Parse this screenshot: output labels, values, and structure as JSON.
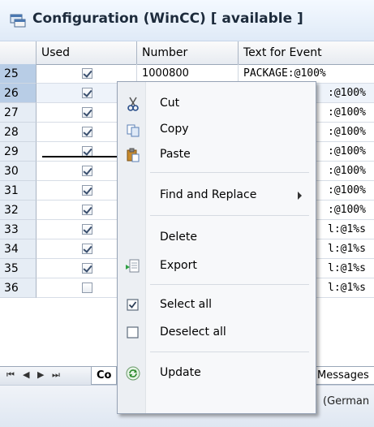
{
  "title": "Configuration (WinCC) [ available ]",
  "columns": [
    "Used",
    "Number",
    "Text for Event"
  ],
  "rows": [
    {
      "num": "25",
      "used": true,
      "number": "1000800",
      "text": "PACKAGE:@100%"
    },
    {
      "num": "26",
      "used": true,
      "number": "",
      "text": ":@100%"
    },
    {
      "num": "27",
      "used": true,
      "number": "",
      "text": ":@100%"
    },
    {
      "num": "28",
      "used": true,
      "number": "",
      "text": ":@100%"
    },
    {
      "num": "29",
      "used": true,
      "number": "",
      "text": ":@100%"
    },
    {
      "num": "30",
      "used": true,
      "number": "",
      "text": ":@100%"
    },
    {
      "num": "31",
      "used": true,
      "number": "",
      "text": ":@100%"
    },
    {
      "num": "32",
      "used": true,
      "number": "",
      "text": ":@100%"
    },
    {
      "num": "33",
      "used": true,
      "number": "",
      "text": "l:@1%s"
    },
    {
      "num": "34",
      "used": true,
      "number": "",
      "text": "l:@1%s"
    },
    {
      "num": "35",
      "used": true,
      "number": "",
      "text": "l:@1%s"
    },
    {
      "num": "36",
      "used": false,
      "number": "",
      "text": "l:@1%s"
    }
  ],
  "nav": {
    "first": "⏮",
    "prev": "◀",
    "next": "▶",
    "last": "⏭"
  },
  "tabs": {
    "left": "Co",
    "right": "Messages"
  },
  "status": {
    "language": "(German"
  },
  "menu": {
    "cut": "Cut",
    "copy": "Copy",
    "paste": "Paste",
    "find_replace": "Find and Replace",
    "delete": "Delete",
    "export": "Export",
    "select_all": "Select all",
    "deselect_all": "Deselect all",
    "update": "Update"
  },
  "colors": {
    "accent": "#3a6fb0",
    "selected_row": "#b8cde6"
  }
}
